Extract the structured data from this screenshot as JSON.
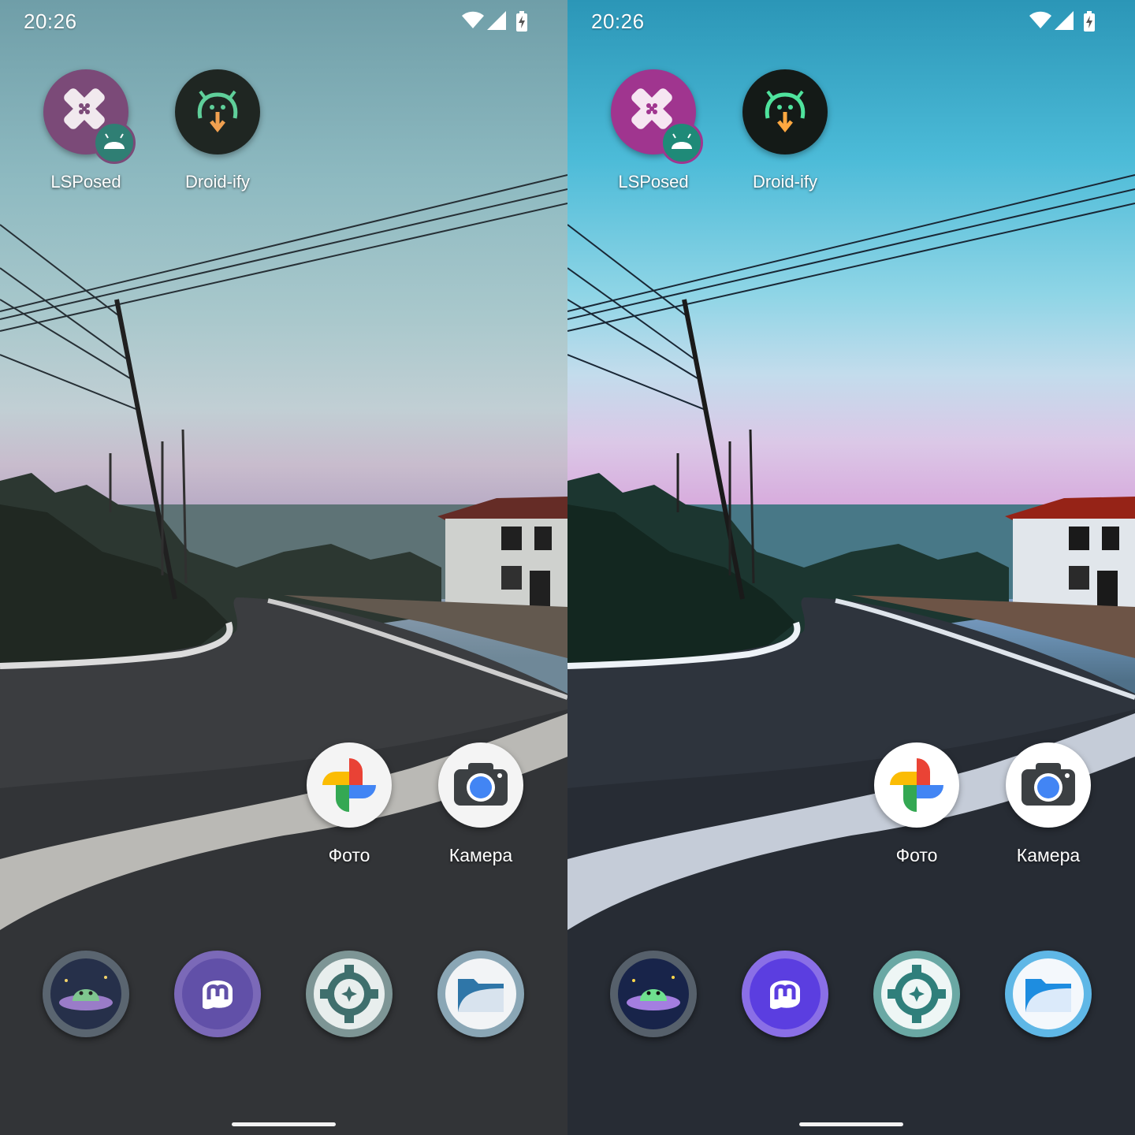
{
  "screens": [
    {
      "variant": "left",
      "status_bar": {
        "time": "20:26",
        "icons": [
          "wifi-icon",
          "cell-signal-icon",
          "battery-charging-icon"
        ]
      },
      "home_apps": [
        {
          "label": "LSPosed",
          "icon": "lsposed-icon"
        },
        {
          "label": "Droid-ify",
          "icon": "droid-ify-icon"
        },
        {
          "label": "Фото",
          "icon": "google-photos-icon"
        },
        {
          "label": "Камера",
          "icon": "camera-icon"
        }
      ],
      "dock_apps": [
        {
          "icon": "ufo-alien-app-icon"
        },
        {
          "icon": "mastodon-icon"
        },
        {
          "icon": "settings-gear-icon"
        },
        {
          "icon": "files-folder-icon"
        }
      ]
    },
    {
      "variant": "right",
      "status_bar": {
        "time": "20:26",
        "icons": [
          "wifi-icon",
          "cell-signal-icon",
          "battery-charging-icon"
        ]
      },
      "home_apps": [
        {
          "label": "LSPosed",
          "icon": "lsposed-icon"
        },
        {
          "label": "Droid-ify",
          "icon": "droid-ify-icon"
        },
        {
          "label": "Фото",
          "icon": "google-photos-icon"
        },
        {
          "label": "Камера",
          "icon": "camera-icon"
        }
      ],
      "dock_apps": [
        {
          "icon": "ufo-alien-app-icon"
        },
        {
          "icon": "mastodon-icon"
        },
        {
          "icon": "settings-gear-icon"
        },
        {
          "icon": "files-folder-icon"
        }
      ]
    }
  ]
}
